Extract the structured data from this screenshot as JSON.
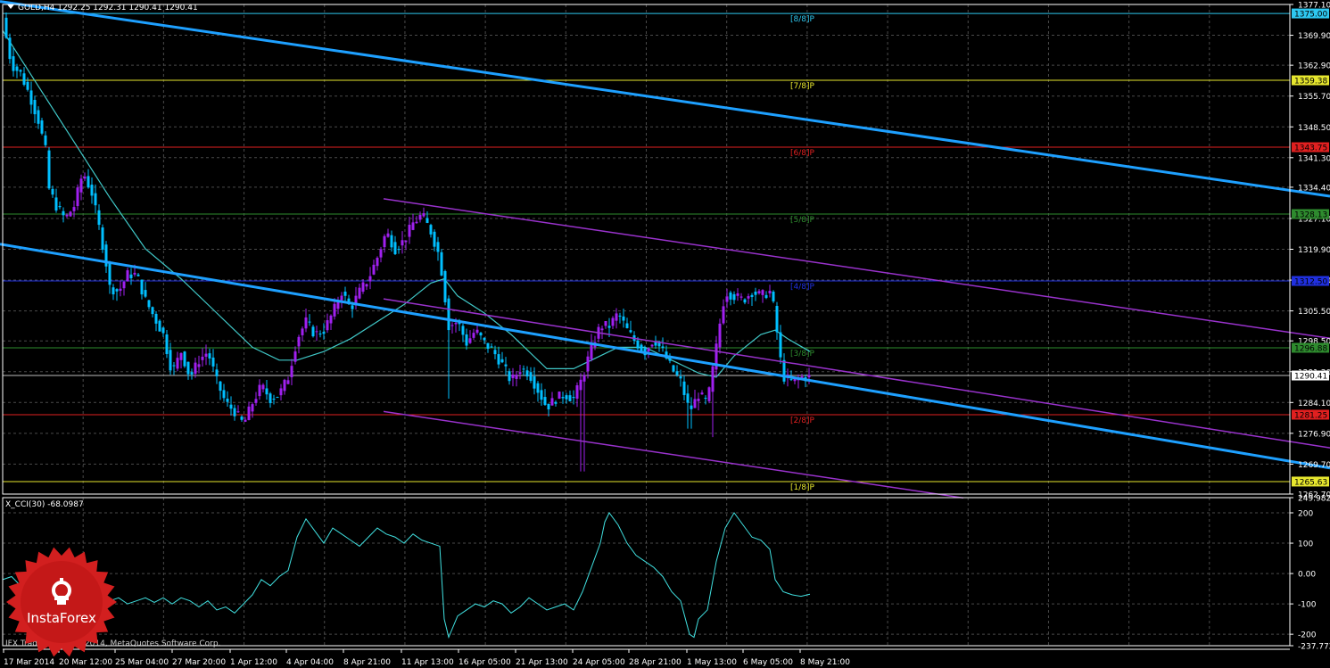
{
  "header": {
    "title": "GOLD,H4  1292.25 1292.31 1290.41 1290.41"
  },
  "indicator": {
    "title": "X_CCI(30) -68.0987"
  },
  "footer": {
    "copyright": "IFX Trader, © 2001-2014, MetaQuotes Software Corp."
  },
  "logo": {
    "text": "InstaForex"
  },
  "colors": {
    "background": "#000000",
    "grid": "#4a4a4a",
    "axis_text": "#ffffff",
    "bull": "#a020f0",
    "bear": "#00bfff",
    "ma": "#40c8c8",
    "channel_blue": "#1ea0ff",
    "channel_purple": "#9932cc",
    "cci": "#40e0e0"
  },
  "chart_data": [
    {
      "type": "candlestick",
      "symbol": "GOLD",
      "timeframe": "H4",
      "ylim": [
        1262.7,
        1377.1
      ],
      "grid": true,
      "price_axis_ticks": [
        "1377.10",
        "1369.90",
        "1362.90",
        "1355.70",
        "1348.50",
        "1341.30",
        "1334.40",
        "1327.10",
        "1319.90",
        "1312.70",
        "1305.50",
        "1298.50",
        "1291.30",
        "1284.10",
        "1276.90",
        "1269.70",
        "1262.70"
      ],
      "time_axis_ticks": [
        "17 Mar 2014",
        "20 Mar 12:00",
        "25 Mar 04:00",
        "27 Mar 20:00",
        "1 Apr 12:00",
        "4 Apr 04:00",
        "8 Apr 21:00",
        "11 Apr 13:00",
        "16 Apr 05:00",
        "21 Apr 13:00",
        "24 Apr 05:00",
        "28 Apr 21:00",
        "1 May 13:00",
        "6 May 05:00",
        "8 May 21:00"
      ],
      "current_price": "1290.41",
      "price_path": [
        [
          0,
          1374
        ],
        [
          6,
          1367
        ],
        [
          10,
          1363
        ],
        [
          20,
          1361
        ],
        [
          30,
          1356
        ],
        [
          40,
          1350
        ],
        [
          48,
          1343
        ],
        [
          52,
          1334
        ],
        [
          60,
          1330
        ],
        [
          70,
          1327
        ],
        [
          80,
          1330
        ],
        [
          90,
          1338
        ],
        [
          100,
          1333
        ],
        [
          108,
          1325
        ],
        [
          115,
          1318
        ],
        [
          120,
          1311
        ],
        [
          130,
          1310
        ],
        [
          140,
          1314
        ],
        [
          150,
          1314
        ],
        [
          160,
          1308
        ],
        [
          170,
          1304
        ],
        [
          180,
          1300
        ],
        [
          190,
          1291
        ],
        [
          200,
          1296
        ],
        [
          210,
          1290
        ],
        [
          220,
          1294
        ],
        [
          230,
          1296
        ],
        [
          240,
          1289
        ],
        [
          250,
          1284
        ],
        [
          260,
          1282
        ],
        [
          270,
          1279
        ],
        [
          280,
          1284
        ],
        [
          290,
          1288
        ],
        [
          300,
          1285
        ],
        [
          310,
          1286
        ],
        [
          320,
          1290
        ],
        [
          330,
          1299
        ],
        [
          340,
          1303
        ],
        [
          350,
          1300
        ],
        [
          360,
          1301
        ],
        [
          370,
          1305
        ],
        [
          380,
          1310
        ],
        [
          390,
          1306
        ],
        [
          400,
          1310
        ],
        [
          410,
          1313
        ],
        [
          420,
          1318
        ],
        [
          430,
          1324
        ],
        [
          440,
          1320
        ],
        [
          450,
          1322
        ],
        [
          460,
          1326
        ],
        [
          470,
          1328
        ],
        [
          480,
          1324
        ],
        [
          490,
          1318
        ],
        [
          500,
          1302
        ],
        [
          510,
          1303
        ],
        [
          520,
          1298
        ],
        [
          530,
          1301
        ],
        [
          540,
          1298
        ],
        [
          550,
          1296
        ],
        [
          560,
          1293
        ],
        [
          570,
          1289
        ],
        [
          580,
          1292
        ],
        [
          590,
          1291
        ],
        [
          600,
          1287
        ],
        [
          610,
          1283
        ],
        [
          620,
          1285
        ],
        [
          630,
          1286
        ],
        [
          640,
          1285
        ],
        [
          650,
          1290
        ],
        [
          660,
          1297
        ],
        [
          670,
          1302
        ],
        [
          680,
          1302
        ],
        [
          690,
          1305
        ],
        [
          700,
          1301
        ],
        [
          710,
          1298
        ],
        [
          720,
          1296
        ],
        [
          730,
          1299
        ],
        [
          740,
          1296
        ],
        [
          750,
          1292
        ],
        [
          760,
          1289
        ],
        [
          770,
          1282
        ],
        [
          780,
          1286
        ],
        [
          790,
          1284
        ],
        [
          800,
          1297
        ],
        [
          805,
          1304
        ],
        [
          810,
          1310
        ],
        [
          820,
          1309
        ],
        [
          830,
          1308
        ],
        [
          840,
          1310
        ],
        [
          850,
          1309
        ],
        [
          860,
          1310
        ],
        [
          866,
          1305
        ],
        [
          870,
          1296
        ],
        [
          876,
          1290
        ],
        [
          885,
          1289
        ],
        [
          895,
          1290
        ],
        [
          905,
          1290
        ]
      ],
      "ma_path": [
        [
          0,
          1371
        ],
        [
          40,
          1358
        ],
        [
          80,
          1345
        ],
        [
          120,
          1332
        ],
        [
          160,
          1320
        ],
        [
          200,
          1313
        ],
        [
          240,
          1305
        ],
        [
          280,
          1297
        ],
        [
          310,
          1294
        ],
        [
          330,
          1294
        ],
        [
          360,
          1296
        ],
        [
          390,
          1299
        ],
        [
          420,
          1303
        ],
        [
          450,
          1307
        ],
        [
          480,
          1312
        ],
        [
          495,
          1313
        ],
        [
          510,
          1309
        ],
        [
          540,
          1305
        ],
        [
          570,
          1300
        ],
        [
          610,
          1292
        ],
        [
          640,
          1292
        ],
        [
          660,
          1294
        ],
        [
          690,
          1297
        ],
        [
          720,
          1297
        ],
        [
          750,
          1294
        ],
        [
          780,
          1291
        ],
        [
          800,
          1290
        ],
        [
          820,
          1295
        ],
        [
          850,
          1300
        ],
        [
          866,
          1301
        ],
        [
          880,
          1299
        ],
        [
          905,
          1296
        ]
      ],
      "horizontal_levels": [
        {
          "label": "[8/8]P",
          "price": "1375.00",
          "color": "#2ec8f0",
          "label_color": "#2ec8f0",
          "tag_bg": "#2ec8f0",
          "tag_color": "#000000"
        },
        {
          "label": "[7/8]P",
          "price": "1359.38",
          "color": "#e6e62e",
          "label_color": "#e6e62e",
          "tag_bg": "#e6e62e",
          "tag_color": "#000000"
        },
        {
          "label": "[6/8]P",
          "price": "1343.75",
          "color": "#e02020",
          "label_color": "#e02020",
          "tag_bg": "#e02020",
          "tag_color": "#000000"
        },
        {
          "label": "[5/8]P",
          "price": "1328.13",
          "color": "#2e8b2e",
          "label_color": "#2e8b2e",
          "tag_bg": "#2e8b2e",
          "tag_color": "#000000"
        },
        {
          "label": "[4/8]P",
          "price": "1312.50",
          "color": "#2030e0",
          "label_color": "#2030e0",
          "tag_bg": "#2030e0",
          "tag_color": "#000000"
        },
        {
          "label": "[3/8]P",
          "price": "1296.88",
          "color": "#2e8b2e",
          "label_color": "#2e8b2e",
          "tag_bg": "#2e8b2e",
          "tag_color": "#000000"
        },
        {
          "label": "[2/8]P",
          "price": "1281.25",
          "color": "#e02020",
          "label_color": "#e02020",
          "tag_bg": "#e02020",
          "tag_color": "#000000"
        },
        {
          "label": "[1/8]P",
          "price": "1265.63",
          "color": "#e6e62e",
          "label_color": "#e6e62e",
          "tag_bg": "#e6e62e",
          "tag_color": "#000000"
        }
      ],
      "trendlines": [
        {
          "name": "blue-channel-upper",
          "color": "#1ea0ff",
          "width": 3,
          "from": [
            0,
            1377.8
          ],
          "to": [
            1491,
            1332.3
          ]
        },
        {
          "name": "blue-channel-lower",
          "color": "#1ea0ff",
          "width": 3,
          "from": [
            0,
            1321.1
          ],
          "to": [
            1491,
            1268.8
          ]
        },
        {
          "name": "purple-channel-upper",
          "color": "#9932cc",
          "width": 1.5,
          "from": [
            430,
            1331.7
          ],
          "to": [
            1491,
            1299.1
          ]
        },
        {
          "name": "purple-channel-middle",
          "color": "#9932cc",
          "width": 1.5,
          "from": [
            430,
            1308.3
          ],
          "to": [
            1491,
            1273.5
          ]
        },
        {
          "name": "purple-channel-lower",
          "color": "#9932cc",
          "width": 1.5,
          "from": [
            430,
            1282.0
          ],
          "to": [
            1080,
            1261.8
          ]
        }
      ]
    },
    {
      "type": "line",
      "name": "X_CCI(30)",
      "ylim": [
        -237.7724,
        249.9824
      ],
      "y_ticks": [
        "249.9824",
        "200",
        "100",
        "0.00",
        "-100",
        "-200",
        "-237.7724"
      ],
      "x_ticks": "shared with price chart",
      "values": [
        [
          0,
          -20
        ],
        [
          10,
          -10
        ],
        [
          20,
          -40
        ],
        [
          30,
          -60
        ],
        [
          40,
          -90
        ],
        [
          50,
          -110
        ],
        [
          60,
          -70
        ],
        [
          70,
          -40
        ],
        [
          80,
          -60
        ],
        [
          90,
          -80
        ],
        [
          100,
          -60
        ],
        [
          110,
          -70
        ],
        [
          120,
          -90
        ],
        [
          130,
          -80
        ],
        [
          140,
          -100
        ],
        [
          150,
          -90
        ],
        [
          160,
          -80
        ],
        [
          170,
          -95
        ],
        [
          180,
          -80
        ],
        [
          190,
          -100
        ],
        [
          200,
          -80
        ],
        [
          210,
          -90
        ],
        [
          220,
          -110
        ],
        [
          230,
          -90
        ],
        [
          240,
          -120
        ],
        [
          250,
          -110
        ],
        [
          260,
          -130
        ],
        [
          270,
          -100
        ],
        [
          280,
          -70
        ],
        [
          290,
          -20
        ],
        [
          300,
          -40
        ],
        [
          310,
          -10
        ],
        [
          320,
          10
        ],
        [
          330,
          120
        ],
        [
          340,
          180
        ],
        [
          350,
          140
        ],
        [
          360,
          100
        ],
        [
          370,
          150
        ],
        [
          380,
          130
        ],
        [
          390,
          110
        ],
        [
          400,
          90
        ],
        [
          410,
          120
        ],
        [
          420,
          150
        ],
        [
          430,
          130
        ],
        [
          440,
          120
        ],
        [
          450,
          100
        ],
        [
          460,
          130
        ],
        [
          470,
          110
        ],
        [
          480,
          100
        ],
        [
          490,
          90
        ],
        [
          495,
          -150
        ],
        [
          500,
          -210
        ],
        [
          510,
          -140
        ],
        [
          520,
          -120
        ],
        [
          530,
          -100
        ],
        [
          540,
          -110
        ],
        [
          550,
          -90
        ],
        [
          560,
          -100
        ],
        [
          570,
          -130
        ],
        [
          580,
          -110
        ],
        [
          590,
          -80
        ],
        [
          600,
          -100
        ],
        [
          610,
          -120
        ],
        [
          620,
          -110
        ],
        [
          630,
          -100
        ],
        [
          640,
          -120
        ],
        [
          650,
          -60
        ],
        [
          660,
          20
        ],
        [
          670,
          100
        ],
        [
          675,
          170
        ],
        [
          680,
          200
        ],
        [
          690,
          160
        ],
        [
          700,
          100
        ],
        [
          710,
          60
        ],
        [
          720,
          40
        ],
        [
          730,
          20
        ],
        [
          740,
          -10
        ],
        [
          750,
          -60
        ],
        [
          760,
          -90
        ],
        [
          770,
          -200
        ],
        [
          775,
          -210
        ],
        [
          780,
          -150
        ],
        [
          790,
          -120
        ],
        [
          800,
          40
        ],
        [
          810,
          150
        ],
        [
          820,
          200
        ],
        [
          830,
          160
        ],
        [
          840,
          120
        ],
        [
          850,
          110
        ],
        [
          860,
          80
        ],
        [
          866,
          -20
        ],
        [
          875,
          -60
        ],
        [
          885,
          -70
        ],
        [
          895,
          -75
        ],
        [
          905,
          -68
        ]
      ]
    }
  ]
}
